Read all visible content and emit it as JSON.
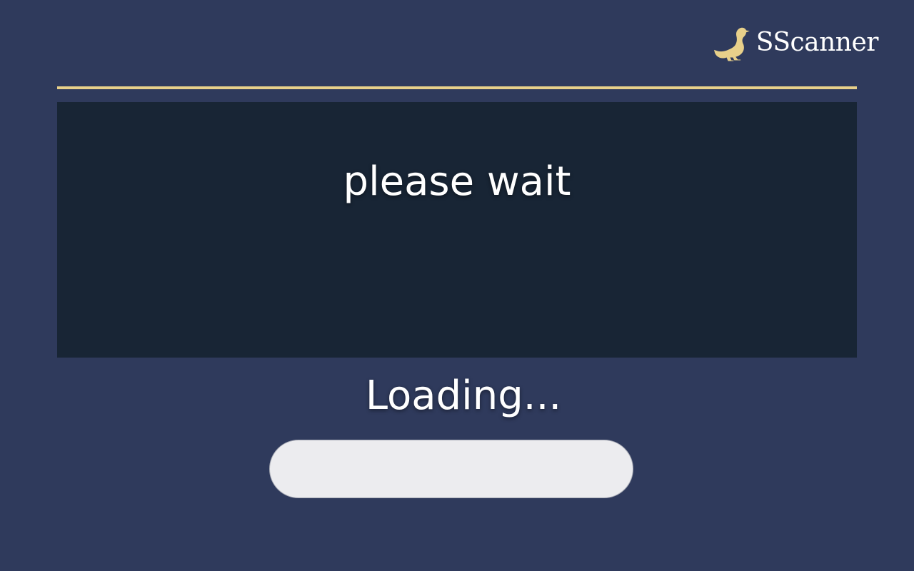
{
  "brand": {
    "name": "SScanner",
    "logo_icon": "duck-icon",
    "logo_color": "#e8d08a"
  },
  "colors": {
    "background": "#2f3a5c",
    "panel": "#182535",
    "accent": "#e8d08a",
    "progress_track": "#ececef"
  },
  "panel": {
    "message": "please wait"
  },
  "loading": {
    "label": "Loading...",
    "progress": 0
  }
}
